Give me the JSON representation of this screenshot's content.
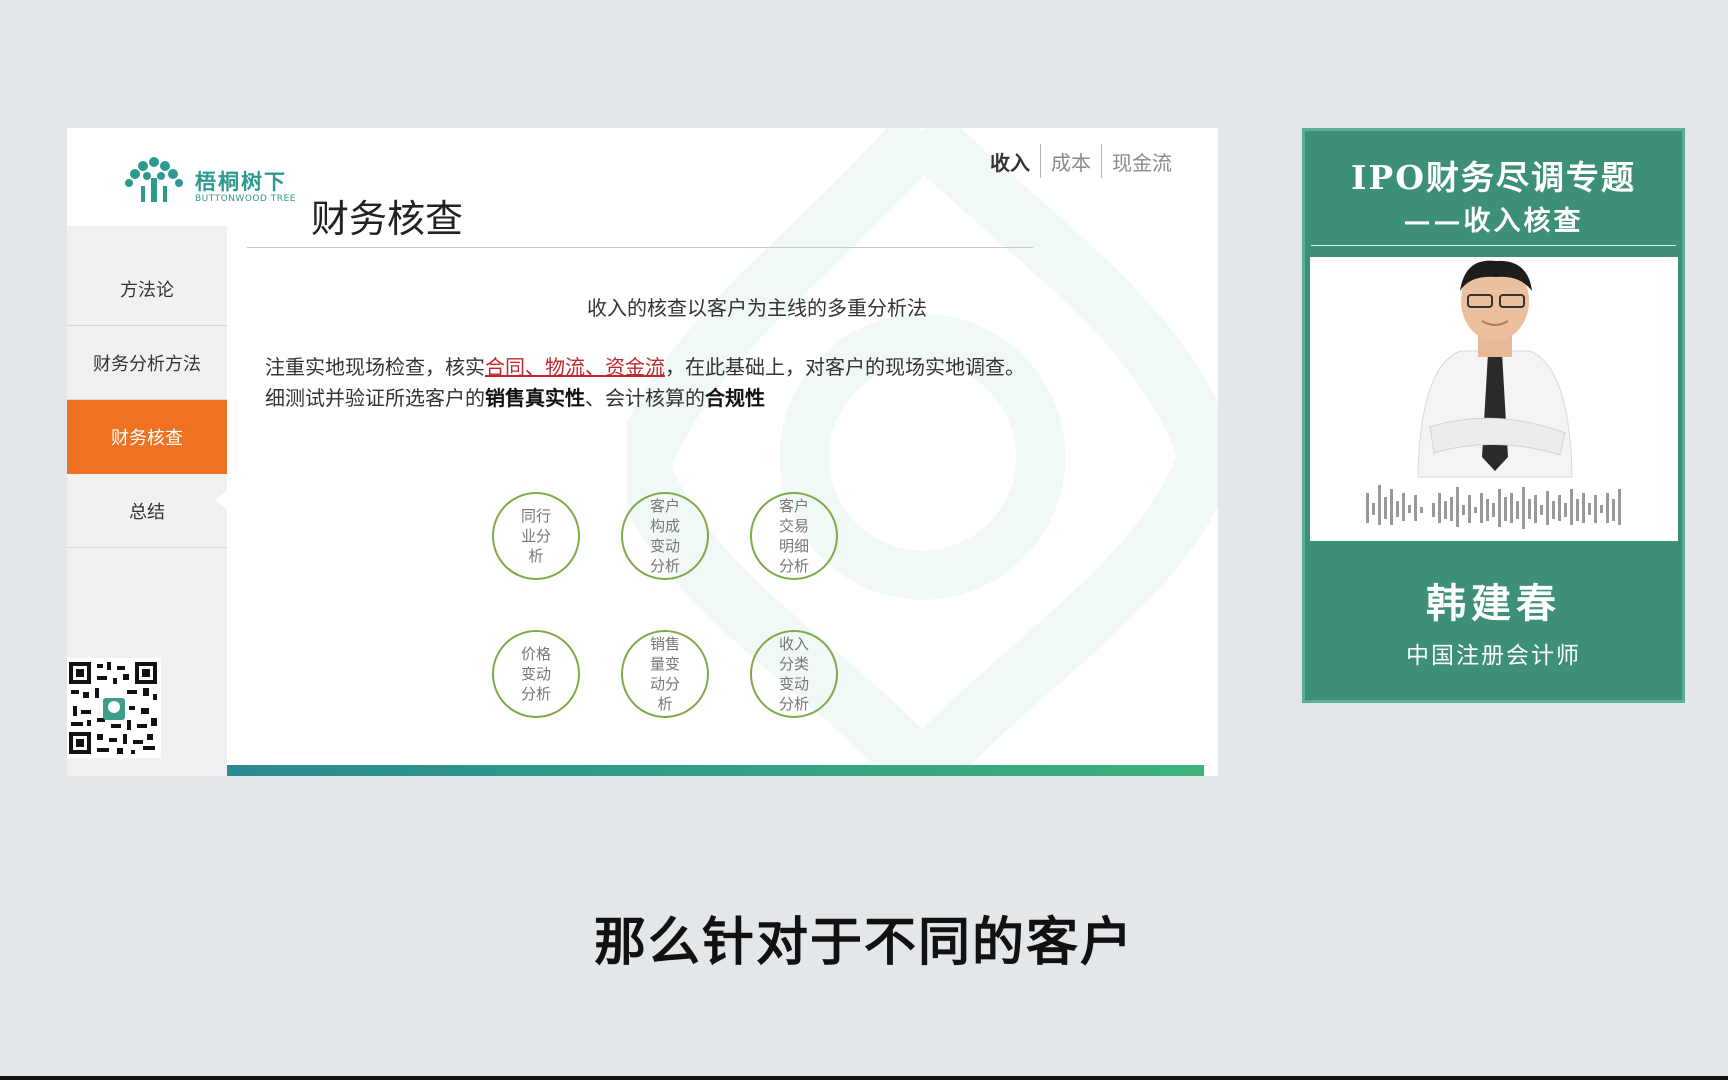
{
  "slide": {
    "logo": {
      "name": "梧桐树下",
      "en": "BUTTONWOOD TREE"
    },
    "tabs": [
      {
        "label": "收入",
        "active": true
      },
      {
        "label": "成本"
      },
      {
        "label": "现金流"
      }
    ],
    "title": "财务核查",
    "sidebar": [
      {
        "label": "方法论"
      },
      {
        "label": "财务分析方法"
      },
      {
        "label": "财务核查",
        "active": true
      },
      {
        "label": "总结"
      }
    ],
    "subtitle": "收入的核查以客户为主线的多重分析法",
    "paragraph": {
      "l1_a": "注重实地现场检查，核实",
      "l1_red": "合同、物流、资金流",
      "l1_b": "，在此基础上，对客户的现场实地调查。",
      "l2_a": "细测试并验证所选客户的",
      "l2_bold1": "销售真实性",
      "l2_b": "、会计核算的",
      "l2_bold2": "合规性"
    },
    "circles": [
      "同行业分析",
      "客户构成变动分析",
      "客户交易明细分析",
      "价格变动分析",
      "销售量变动分析",
      "收入分类变动分析"
    ],
    "accent_colors": {
      "orange": "#ef7222",
      "green_ring": "#7faa48",
      "teal": "#2a8c92"
    }
  },
  "card": {
    "title": "IPO财务尽调专题",
    "subtitle": "——收入核查",
    "presenter": "韩建春",
    "role": "中国注册会计师",
    "bg_color": "#3d8f78"
  },
  "caption": "那么针对于不同的客户"
}
